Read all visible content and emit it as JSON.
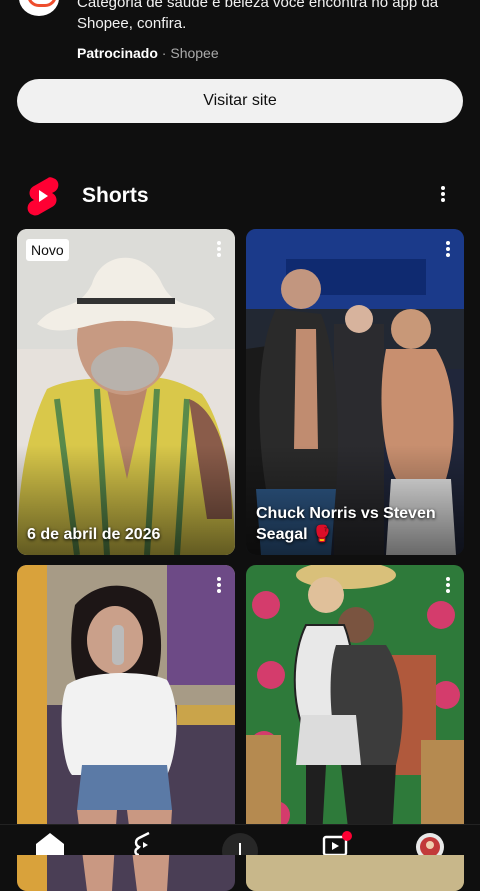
{
  "ad": {
    "description": "Categoria de saúde e beleza você encontra no app da Shopee, confira.",
    "sponsored_label": "Patrocinado",
    "separator": "·",
    "advertiser": "Shopee",
    "cta_label": "Visitar site",
    "brand_color": "#ee4d2d"
  },
  "shorts": {
    "section_title": "Shorts",
    "accent": "#ff0033",
    "items": [
      {
        "badge": "Novo",
        "caption": "6 de abril de 2026"
      },
      {
        "caption": "Chuck Norris vs Steven Seagal 🥊"
      },
      {
        "caption": ""
      },
      {
        "caption": ""
      }
    ]
  },
  "bottom_nav": {
    "items": [
      {
        "icon": "home-icon"
      },
      {
        "icon": "shorts-icon"
      },
      {
        "icon": "create-icon"
      },
      {
        "icon": "subscriptions-icon"
      },
      {
        "icon": "avatar-icon"
      }
    ]
  }
}
